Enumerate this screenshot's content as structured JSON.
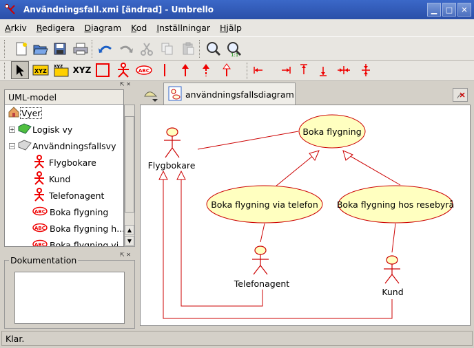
{
  "window": {
    "title": "Användningsfall.xmi [ändrad] - Umbrello",
    "controls": [
      "minimize",
      "maximize",
      "close"
    ]
  },
  "menubar": [
    {
      "label": "Arkiv",
      "mnemonic": "A",
      "rest": "rkiv"
    },
    {
      "label": "Redigera",
      "mnemonic": "R",
      "rest": "edigera"
    },
    {
      "label": "Diagram",
      "mnemonic": "D",
      "rest": "iagram"
    },
    {
      "label": "Kod",
      "mnemonic": "K",
      "rest": "od"
    },
    {
      "label": "Inställningar",
      "mnemonic": "I",
      "rest": "nställningar"
    },
    {
      "label": "Hjälp",
      "mnemonic": "H",
      "rest": "jälp"
    }
  ],
  "toolbar_main": [
    "new-document-icon",
    "open-folder-icon",
    "save-icon",
    "print-icon",
    "undo-icon",
    "redo-icon",
    "cut-icon",
    "copy-icon",
    "paste-icon",
    "zoom-in-icon",
    "zoom-100-icon"
  ],
  "toolbar_diagram": {
    "tools": [
      "select-arrow-icon",
      "text-xyz-box-icon",
      "text-xyz-note-icon",
      "text-xyz-label",
      "box-icon",
      "actor-icon",
      "usecase-icon",
      "line-icon",
      "arrow-up-icon",
      "dashed-arrow-up-icon",
      "open-arrow-up-icon",
      "align-left-icon",
      "align-right-icon",
      "align-top-icon",
      "align-bottom-icon",
      "align-h-center-icon",
      "align-v-center-icon"
    ],
    "xyz_label": "XYZ",
    "accent": "#e00000"
  },
  "tree": {
    "header": "UML-model",
    "items": [
      {
        "label": "Vyer",
        "icon": "home-icon",
        "level": 0,
        "selected": true
      },
      {
        "label": "Logisk vy",
        "icon": "green-folder-icon",
        "level": 1,
        "expander": "+"
      },
      {
        "label": "Användningsfallsvy",
        "icon": "grey-folder-icon",
        "level": 1,
        "expander": "−"
      },
      {
        "label": "Flygbokare",
        "icon": "actor-icon",
        "level": 2
      },
      {
        "label": "Kund",
        "icon": "actor-icon",
        "level": 2
      },
      {
        "label": "Telefonagent",
        "icon": "actor-icon",
        "level": 2
      },
      {
        "label": "Boka flygning",
        "icon": "usecase-icon",
        "level": 2
      },
      {
        "label": "Boka flygning h...",
        "icon": "usecase-icon",
        "level": 2
      },
      {
        "label": "Boka flygning vi...",
        "icon": "usecase-icon",
        "level": 2
      }
    ]
  },
  "documentation": {
    "legend": "Dokumentation",
    "text": ""
  },
  "tabs": [
    {
      "label": "användningsfallsdiagram",
      "active": true
    }
  ],
  "diagram": {
    "actors": [
      {
        "name": "Flygbokare"
      },
      {
        "name": "Telefonagent"
      },
      {
        "name": "Kund"
      }
    ],
    "usecases": [
      {
        "name": "Boka flygning"
      },
      {
        "name": "Boka flygning via telefon"
      },
      {
        "name": "Boka flygning hos resebyrå"
      }
    ],
    "colors": {
      "usecase_fill": "#ffffc0",
      "line": "#cc0000"
    }
  },
  "status": "Klar."
}
